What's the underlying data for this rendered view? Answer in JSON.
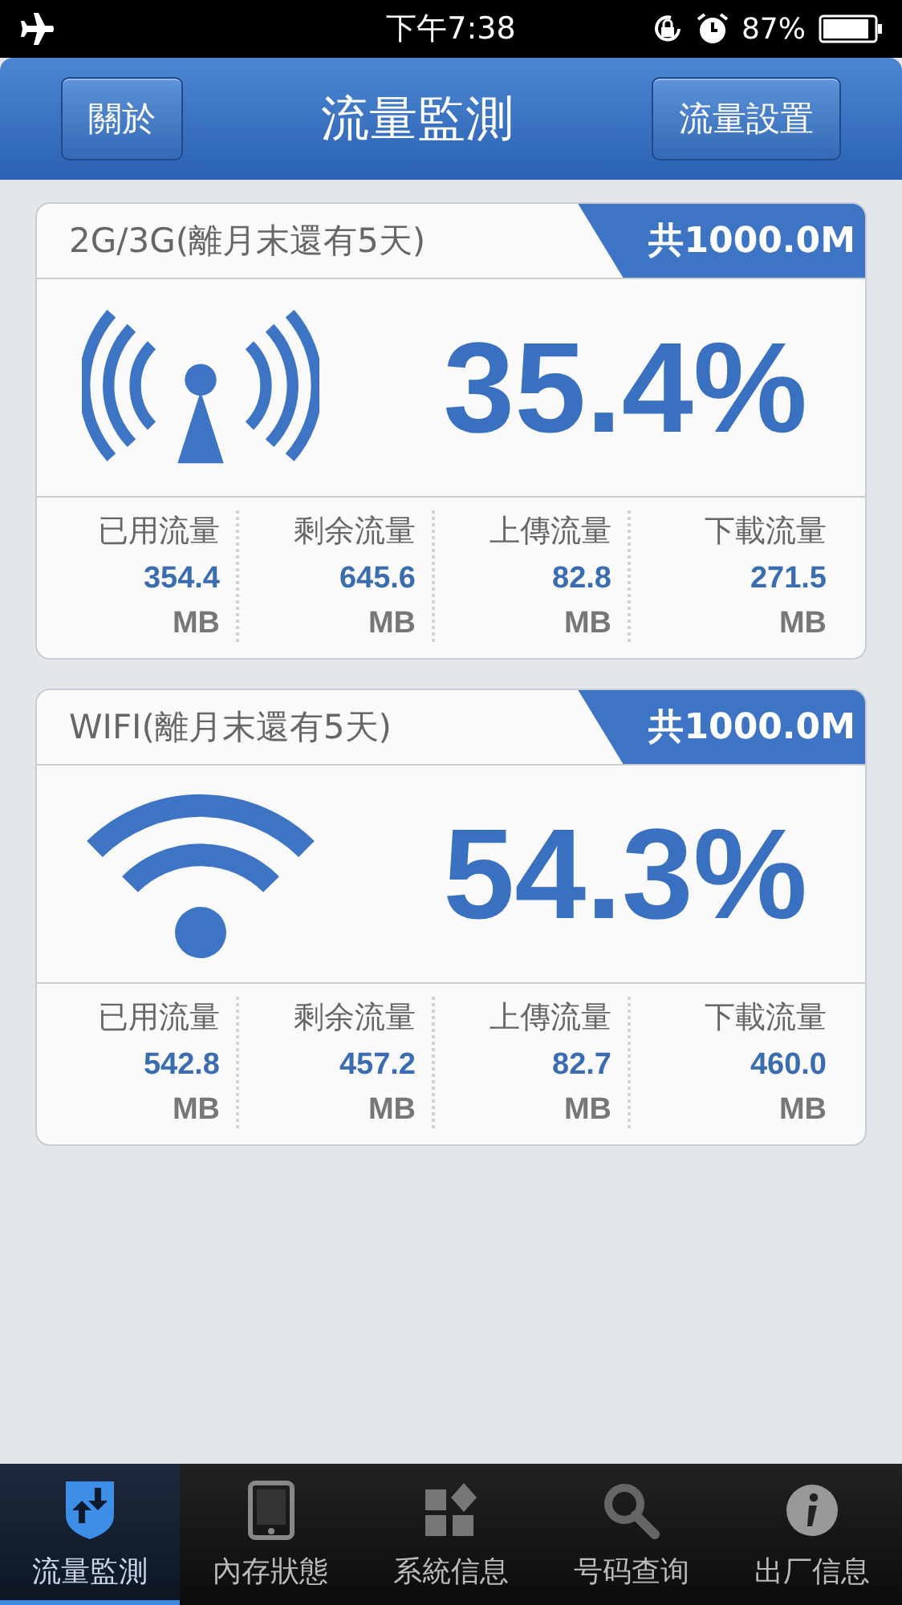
{
  "status_bar": {
    "time": "下午7:38",
    "battery": "87%"
  },
  "nav_bar": {
    "left_button": "關於",
    "title": "流量監測",
    "right_button": "流量設置"
  },
  "cards": [
    {
      "kind": "cellular",
      "title": "2G/3G(離月末還有5天)",
      "total": "共1000.0M",
      "percent": "35.4%",
      "stats": [
        {
          "label": "已用流量",
          "value": "354.4",
          "unit": "MB"
        },
        {
          "label": "剩余流量",
          "value": "645.6",
          "unit": "MB"
        },
        {
          "label": "上傳流量",
          "value": "82.8",
          "unit": "MB"
        },
        {
          "label": "下載流量",
          "value": "271.5",
          "unit": "MB"
        }
      ]
    },
    {
      "kind": "wifi",
      "title": "WIFI(離月末還有5天)",
      "total": "共1000.0M",
      "percent": "54.3%",
      "stats": [
        {
          "label": "已用流量",
          "value": "542.8",
          "unit": "MB"
        },
        {
          "label": "剩余流量",
          "value": "457.2",
          "unit": "MB"
        },
        {
          "label": "上傳流量",
          "value": "82.7",
          "unit": "MB"
        },
        {
          "label": "下載流量",
          "value": "460.0",
          "unit": "MB"
        }
      ]
    }
  ],
  "tab_bar": [
    {
      "kind": "traffic",
      "label": "流量監測",
      "selected": true
    },
    {
      "kind": "memory",
      "label": "內存狀態",
      "selected": false
    },
    {
      "kind": "system",
      "label": "系統信息",
      "selected": false
    },
    {
      "kind": "lookup",
      "label": "号码查询",
      "selected": false
    },
    {
      "kind": "info",
      "label": "出厂信息",
      "selected": false
    }
  ]
}
